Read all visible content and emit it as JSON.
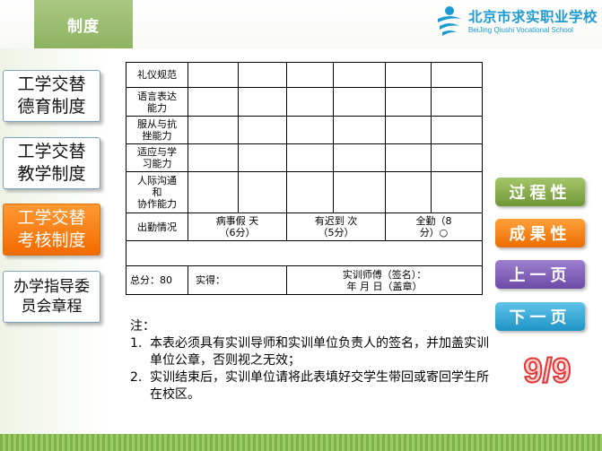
{
  "header": {
    "section_title": "制度",
    "logo_cn": "北京市求实职业学校",
    "logo_en": "BeiJing Qiushi Vocational School"
  },
  "nav": {
    "items": [
      {
        "label": "工学交替\n德育制度",
        "active": false
      },
      {
        "label": "工学交替\n教学制度",
        "active": false
      },
      {
        "label": "工学交替\n考核制度",
        "active": true
      },
      {
        "label": "办学指导委\n员会章程",
        "active": false
      }
    ]
  },
  "table": {
    "rows": [
      {
        "label": "礼仪规范"
      },
      {
        "label": "语言表达\n能力"
      },
      {
        "label": "服从与抗\n挫能力"
      },
      {
        "label": "适应与学\n习能力"
      },
      {
        "label": "人际沟通\n和\n协作能力"
      }
    ],
    "attendance": {
      "label": "出勤情况",
      "sick_leave": "病事假    天\n（6分）",
      "late": "有迟到    次\n（5分）",
      "full": "全勤（8\n分）○"
    },
    "total_label": "总分：80",
    "actual_label": "实得：",
    "mentor_sign": "实训师傅（签名）：\n年  月  日（盖章）"
  },
  "notes": {
    "title": "注：",
    "items": [
      {
        "num": "1.",
        "text": "本表必须具有实训导师和实训单位负责人的签名，并加盖实训单位公章，否则视之无效；"
      },
      {
        "num": "2.",
        "text": "实训结束后，实训单位请将此表填好交学生带回或寄回学生所在校区。"
      }
    ]
  },
  "buttons": {
    "process": "过程性",
    "result": "成果性",
    "prev": "上一页",
    "next": "下一页"
  },
  "page_number": "9/9",
  "colors": {
    "accent_green": "#8fb262",
    "active_orange": "#f26b00",
    "logo_blue": "#1f9bd3"
  }
}
